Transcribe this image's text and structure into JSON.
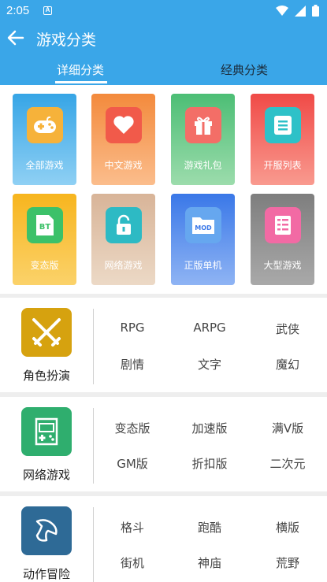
{
  "status_bar": {
    "time": "2:05",
    "notif": "A"
  },
  "appbar": {
    "title": "游戏分类"
  },
  "tabs": [
    {
      "label": "详细分类",
      "selected": true
    },
    {
      "label": "经典分类",
      "selected": false
    }
  ],
  "tiles": [
    {
      "label": "全部游戏",
      "icon": "gamepad-icon"
    },
    {
      "label": "中文游戏",
      "icon": "heart-icon"
    },
    {
      "label": "游戏礼包",
      "icon": "gift-icon"
    },
    {
      "label": "开服列表",
      "icon": "list-icon"
    },
    {
      "label": "变态版",
      "icon": "bt-icon",
      "icon_text": "BT"
    },
    {
      "label": "网络游戏",
      "icon": "unlock-icon"
    },
    {
      "label": "正版单机",
      "icon": "mod-folder-icon",
      "icon_text": "MOD"
    },
    {
      "label": "大型游戏",
      "icon": "server-icon"
    }
  ],
  "sections": [
    {
      "name": "角色扮演",
      "icon": "crossed-swords-icon",
      "color": "#d6a20f",
      "tags": [
        "RPG",
        "ARPG",
        "武侠",
        "剧情",
        "文字",
        "魔幻"
      ]
    },
    {
      "name": "网络游戏",
      "icon": "arcade-icon",
      "color": "#2fae6e",
      "tags": [
        "变态版",
        "加速版",
        "满V版",
        "GM版",
        "折扣版",
        "二次元"
      ]
    },
    {
      "name": "动作冒险",
      "icon": "boomerang-icon",
      "color": "#2e6a96",
      "tags": [
        "格斗",
        "跑酷",
        "横版",
        "街机",
        "神庙",
        "荒野"
      ]
    }
  ]
}
